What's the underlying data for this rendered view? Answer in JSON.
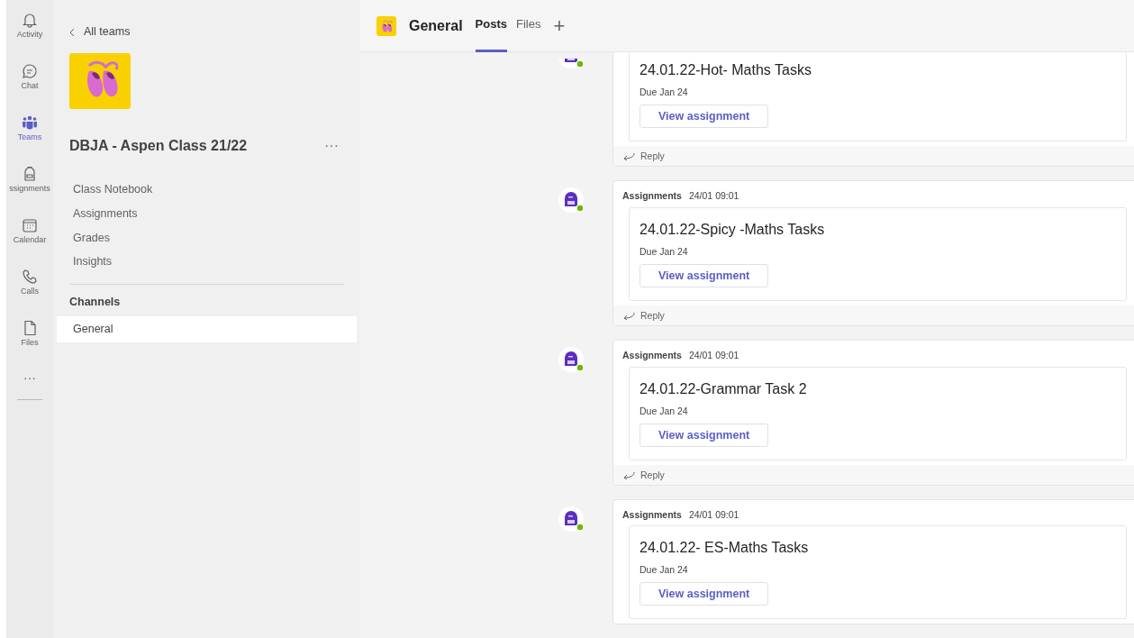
{
  "rail": [
    {
      "label": "Activity",
      "selected": false
    },
    {
      "label": "Chat",
      "selected": false
    },
    {
      "label": "Teams",
      "selected": true
    },
    {
      "label": "ssignments",
      "selected": false
    },
    {
      "label": "Calendar",
      "selected": false
    },
    {
      "label": "Calls",
      "selected": false
    },
    {
      "label": "Files",
      "selected": false
    }
  ],
  "rail_more": "···",
  "sidebar": {
    "back": "All teams",
    "team_name": "DBJA - Aspen Class 21/22",
    "more": "···",
    "items": [
      {
        "label": "Class Notebook"
      },
      {
        "label": "Assignments"
      },
      {
        "label": "Grades"
      },
      {
        "label": "Insights"
      }
    ],
    "channels_heading": "Channels",
    "channels": [
      {
        "label": "General",
        "selected": true
      }
    ]
  },
  "header": {
    "channel": "General",
    "tabs": [
      {
        "label": "Posts",
        "selected": true
      },
      {
        "label": "Files",
        "selected": false
      }
    ],
    "add": "+"
  },
  "posts": [
    {
      "title": "24.01.22-Hot- Maths Tasks",
      "due": "Due Jan 24",
      "button": "View assignment",
      "reply": "Reply"
    },
    {
      "author": "Assignments",
      "time": "24/01 09:01",
      "title": "24.01.22-Spicy -Maths Tasks",
      "due": "Due Jan 24",
      "button": "View assignment",
      "reply": "Reply"
    },
    {
      "author": "Assignments",
      "time": "24/01 09:01",
      "title": "24.01.22-Grammar Task 2",
      "due": "Due Jan 24",
      "button": "View assignment",
      "reply": "Reply"
    },
    {
      "author": "Assignments",
      "time": "24/01 09:01",
      "title": "24.01.22- ES-Maths Tasks",
      "due": "Due Jan 24",
      "button": "View assignment"
    }
  ]
}
